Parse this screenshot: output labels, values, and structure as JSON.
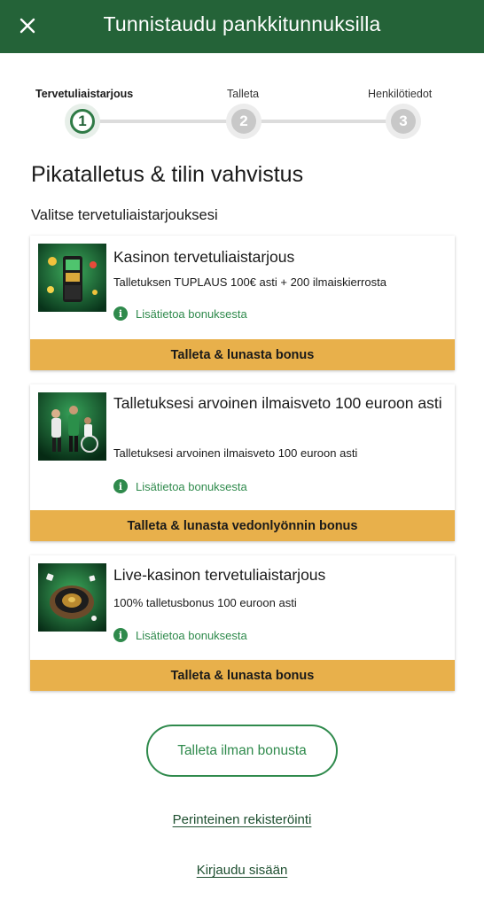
{
  "header": {
    "title": "Tunnistaudu pankkitunnuksilla",
    "close_icon": "close-icon"
  },
  "stepper": {
    "steps": [
      {
        "number": "1",
        "label": "Tervetuliaistarjous",
        "active": true
      },
      {
        "number": "2",
        "label": "Talleta",
        "active": false
      },
      {
        "number": "3",
        "label": "Henkilötiedot",
        "active": false
      }
    ]
  },
  "page": {
    "title": "Pikatalletus & tilin vahvistus",
    "subtitle": "Valitse tervetuliaistarjouksesi"
  },
  "offers": [
    {
      "title": "Kasinon tervetuliaistarjous",
      "description": "Talletuksen TUPLAUS 100€ asti + 200 ilmaiskierrosta",
      "info_link": "Lisätietoa bonuksesta",
      "button": "Talleta & lunasta bonus",
      "image": "slot-machine-image"
    },
    {
      "title": "Talletuksesi arvoinen ilmaisveto 100 euroon asti",
      "description": "Talletuksesi arvoinen ilmaisveto 100 euroon asti",
      "info_link": "Lisätietoa bonuksesta",
      "button": "Talleta & lunasta vedonlyönnin bonus",
      "image": "sports-athletes-image"
    },
    {
      "title": "Live-kasinon tervetuliaistarjous",
      "description": "100% talletusbonus 100 euroon asti",
      "info_link": "Lisätietoa bonuksesta",
      "button": "Talleta & lunasta bonus",
      "image": "roulette-wheel-image"
    }
  ],
  "actions": {
    "no_bonus": "Talleta ilman bonusta",
    "traditional_register": "Perinteinen rekisteröinti",
    "login": "Kirjaudu sisään"
  },
  "colors": {
    "brand_green": "#246338",
    "accent_green": "#2f8a4c",
    "button_yellow": "#e8b04b"
  }
}
